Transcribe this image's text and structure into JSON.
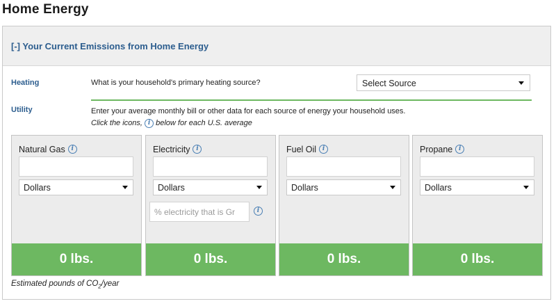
{
  "page": {
    "title": "Home Energy"
  },
  "section": {
    "header": "[-] Your Current Emissions from Home Energy"
  },
  "heating": {
    "label": "Heating",
    "question": "What is your household's primary heating source?",
    "select_value": "Select Source"
  },
  "utility": {
    "label": "Utility",
    "instructions_line1": "Enter your average monthly bill or other data for each source of energy your household uses.",
    "instructions_line2_pre": "Click the icons,",
    "instructions_line2_post": "below for each U.S. average"
  },
  "cards": [
    {
      "title": "Natural Gas",
      "input_value": "",
      "unit": "Dollars",
      "result": "0 lbs."
    },
    {
      "title": "Electricity",
      "input_value": "",
      "unit": "Dollars",
      "percent_placeholder": "% electricity that is Gr",
      "result": "0 lbs."
    },
    {
      "title": "Fuel Oil",
      "input_value": "",
      "unit": "Dollars",
      "result": "0 lbs."
    },
    {
      "title": "Propane",
      "input_value": "",
      "unit": "Dollars",
      "result": "0 lbs."
    }
  ],
  "footnote": {
    "prefix": "Estimated pounds of CO",
    "subscript": "2",
    "suffix": "/year"
  },
  "colors": {
    "accent_blue": "#2c5d8e",
    "result_green": "#6db861",
    "card_background": "#ececec"
  },
  "icons": {
    "info": "info-icon",
    "dropdown": "chevron-down-icon"
  }
}
